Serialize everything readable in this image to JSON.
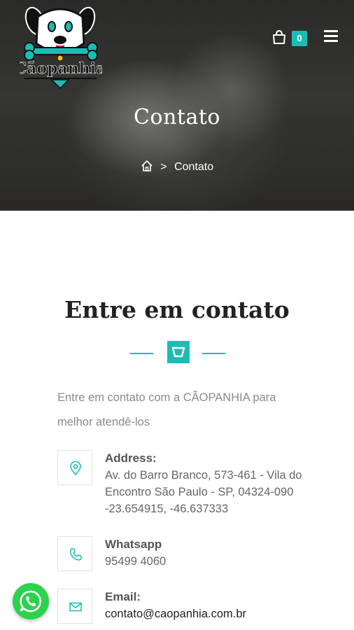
{
  "header": {
    "logo_text": "Cãopanhia",
    "cart_count": "0"
  },
  "hero": {
    "title": "Contato",
    "breadcrumb_current": "Contato",
    "breadcrumb_sep": ">"
  },
  "section": {
    "title": "Entre em contato",
    "intro": "Entre em contato com a CÃOPANHIA para melhor atendê-los"
  },
  "contact": {
    "address_label": "Address:",
    "address_value": "Av. do Barro Branco, 573-461 - Vila do Encontro São Paulo - SP, 04324-090 -23.654915, -46.637333",
    "whatsapp_label": "Whatsapp",
    "whatsapp_value": "95499 4060",
    "email_label": "Email:",
    "email_value": "contato@caopanhia.com.br"
  },
  "colors": {
    "accent": "#1cbcb4",
    "whatsapp": "#2bd24e"
  },
  "icons": [
    "logo-dog-icon",
    "cart-icon",
    "menu-icon",
    "home-icon",
    "location-icon",
    "phone-icon",
    "mail-icon",
    "whatsapp-icon"
  ]
}
